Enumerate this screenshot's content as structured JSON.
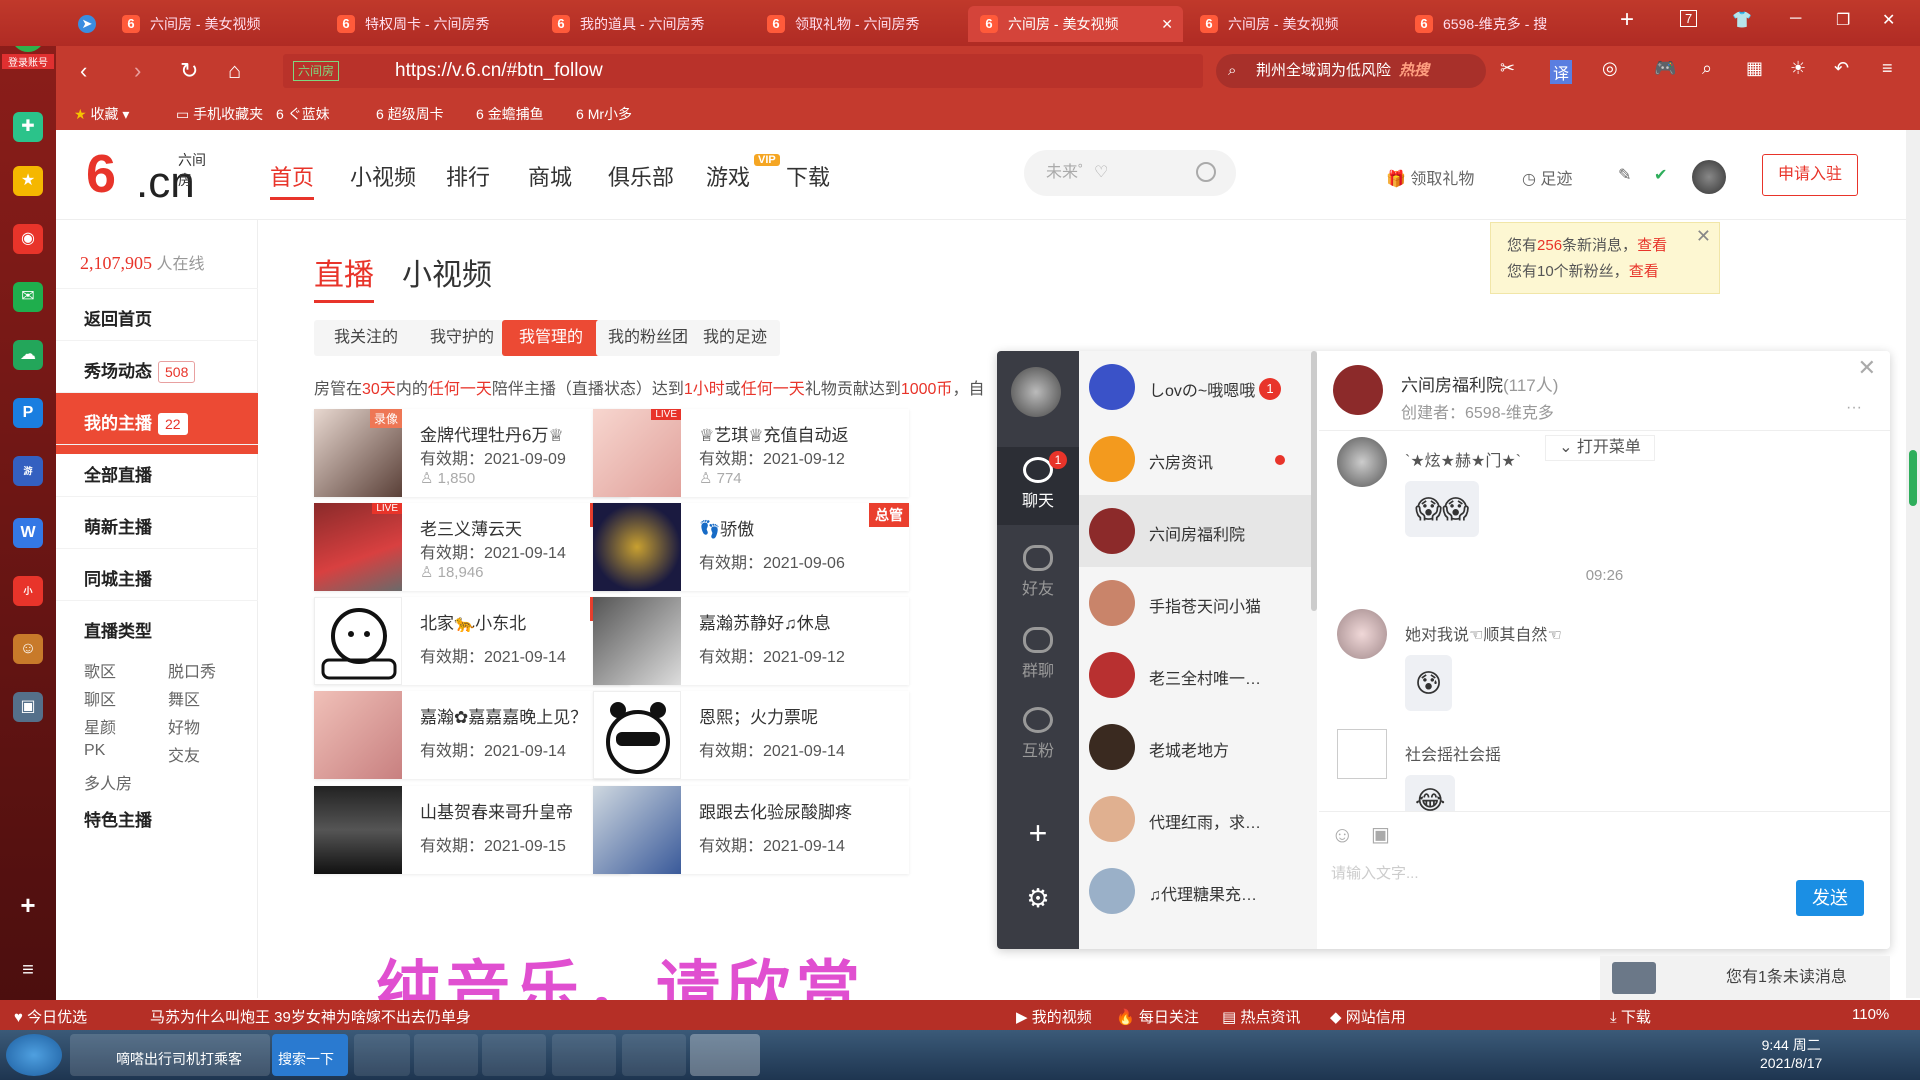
{
  "browser": {
    "tabs": [
      "六间房 - 美女视频",
      "特权周卡 - 六间房秀",
      "我的道具 - 六间房秀",
      "领取礼物 - 六间房秀",
      "六间房 - 美女视频",
      "六间房 - 美女视频",
      "6598-维克多 - 搜"
    ],
    "tab_count": "7",
    "url": "https://v.6.cn/#btn_follow",
    "url_badge": "六间房",
    "search": "荆州全域调为低风险",
    "search_hot": "热搜",
    "bookmarks": [
      "收藏",
      "手机收藏夹",
      "ぐ蓝妹",
      "超级周卡",
      "金蟾捕鱼",
      "Mr小多"
    ],
    "login": "登录账号"
  },
  "site": {
    "logo_top": "六间房",
    "logo_six": "6",
    "logo_cn": ".cn",
    "nav": [
      "首页",
      "小视频",
      "排行",
      "商城",
      "俱乐部",
      "游戏",
      "下载"
    ],
    "vip": "VIP",
    "search_placeholder": "未来゜♡",
    "gift": "领取礼物",
    "footprint": "足迹",
    "apply": "申请入驻",
    "notice": {
      "a1": "您有",
      "n1": "256",
      "a2": "条新消息，",
      "l1": "查看",
      "b1": "您有10个新粉丝，",
      "l2": "查看"
    }
  },
  "sidebar": {
    "online_count": "2,107,905",
    "online_label": "人在线",
    "items": [
      {
        "label": "返回首页",
        "badge": ""
      },
      {
        "label": "秀场动态",
        "badge": "508"
      },
      {
        "label": "我的主播",
        "badge": "22"
      },
      {
        "label": "全部直播",
        "badge": ""
      },
      {
        "label": "萌新主播",
        "badge": ""
      },
      {
        "label": "同城主播",
        "badge": ""
      }
    ],
    "types_title": "直播类型",
    "types": [
      "歌区",
      "脱口秀",
      "聊区",
      "舞区",
      "星颜",
      "好物",
      "PK",
      "交友",
      "多人房"
    ],
    "special": "特色主播"
  },
  "main": {
    "tabs": [
      "直播",
      "小视频"
    ],
    "filters": [
      "我关注的",
      "我守护的",
      "我管理的",
      "我的粉丝团",
      "我的足迹"
    ],
    "rule": {
      "p1": "房管在",
      "r1": "30天",
      "p2": "内的",
      "r2": "任何一天",
      "p3": "陪伴主播（直播状态）达到",
      "r3": "1小时",
      "p4": "或",
      "r4": "任何一天",
      "p5": "礼物贡献达到",
      "r5": "1000币",
      "p6": "，自"
    },
    "cards": [
      {
        "title": "金牌代理牡丹6万♕",
        "exp": "有效期：2021-09-09",
        "fans": "1,850",
        "tag": "",
        "corner": "录像"
      },
      {
        "title": "♕艺琪♕充值自动返",
        "exp": "有效期：2021-09-12",
        "fans": "774",
        "tag": "",
        "corner": "LIVE"
      },
      {
        "title": "老三义薄云天",
        "exp": "有效期：2021-09-14",
        "fans": "18,946",
        "tag": "总管",
        "corner": "LIVE"
      },
      {
        "title": "👣骄傲",
        "exp": "有效期：2021-09-06",
        "fans": "",
        "tag": "总管",
        "corner": ""
      },
      {
        "title": "北家🐆小东北",
        "exp": "有效期：2021-09-14",
        "fans": "",
        "tag": "总管",
        "corner": ""
      },
      {
        "title": "嘉瀚苏静好♫休息",
        "exp": "有效期：2021-09-12",
        "fans": "",
        "tag": "",
        "corner": ""
      },
      {
        "title": "嘉瀚✿嘉嘉嘉晚上见？",
        "exp": "有效期：2021-09-14",
        "fans": "",
        "tag": "",
        "corner": ""
      },
      {
        "title": "恩熙；火力票呢",
        "exp": "有效期：2021-09-14",
        "fans": "",
        "tag": "",
        "corner": ""
      },
      {
        "title": "山基贺春来哥升皇帝",
        "exp": "有效期：2021-09-15",
        "fans": "",
        "tag": "",
        "corner": ""
      },
      {
        "title": "跟跟去化验尿酸脚疼",
        "exp": "有效期：2021-09-14",
        "fans": "",
        "tag": "",
        "corner": ""
      }
    ]
  },
  "chat": {
    "rail": [
      "聊天",
      "好友",
      "群聊",
      "互粉"
    ],
    "chat_badge": "1",
    "contacts": [
      {
        "name": "しovの~哦嗯哦",
        "badge": "1",
        "color": "#3a52c8"
      },
      {
        "name": "六房资讯",
        "badge": "",
        "color": "#f39a1e"
      },
      {
        "name": "六间房福利院",
        "badge": "",
        "color": "#8c2a2a"
      },
      {
        "name": "手指苍天问小猫",
        "badge": "",
        "color": "#c9846a"
      },
      {
        "name": "老三全村唯一…",
        "badge": "",
        "color": "#b83030"
      },
      {
        "name": "老城老地方",
        "badge": "",
        "color": "#3a2a20"
      },
      {
        "name": "代理红雨，求…",
        "badge": "",
        "color": "#e0b090"
      },
      {
        "name": "♫代理糖果充…",
        "badge": "",
        "color": "#9ab0c8"
      }
    ],
    "group_name": "六间房福利院",
    "group_count": "(117人)",
    "creator": "创建者：6598-维克多",
    "open_menu": "打开菜单",
    "time": "09:26",
    "messages": [
      {
        "name": "`★炫★赫★门★`",
        "emoji": "😱😱"
      },
      {
        "name": "她对我说☜顺其自然☜",
        "emoji": "😰"
      },
      {
        "name": "社会摇社会摇",
        "emoji": "😂"
      }
    ],
    "input_placeholder": "请输入文字...",
    "send": "发送"
  },
  "unread": "您有1条未读消息",
  "video_subtitle": "纯音乐，请欣赏",
  "statusbar": {
    "left": [
      "今日优选",
      "马苏为什么叫炮王 39岁女神为啥嫁不出去仍单身"
    ],
    "right": [
      "我的视频",
      "每日关注",
      "热点资讯",
      "网站信用",
      "下载",
      "110%"
    ]
  },
  "taskbar": {
    "ie_task": "嘀嗒出行司机打乘客",
    "search_btn": "搜索一下",
    "time": "9:44 周二",
    "date": "2021/8/17"
  }
}
